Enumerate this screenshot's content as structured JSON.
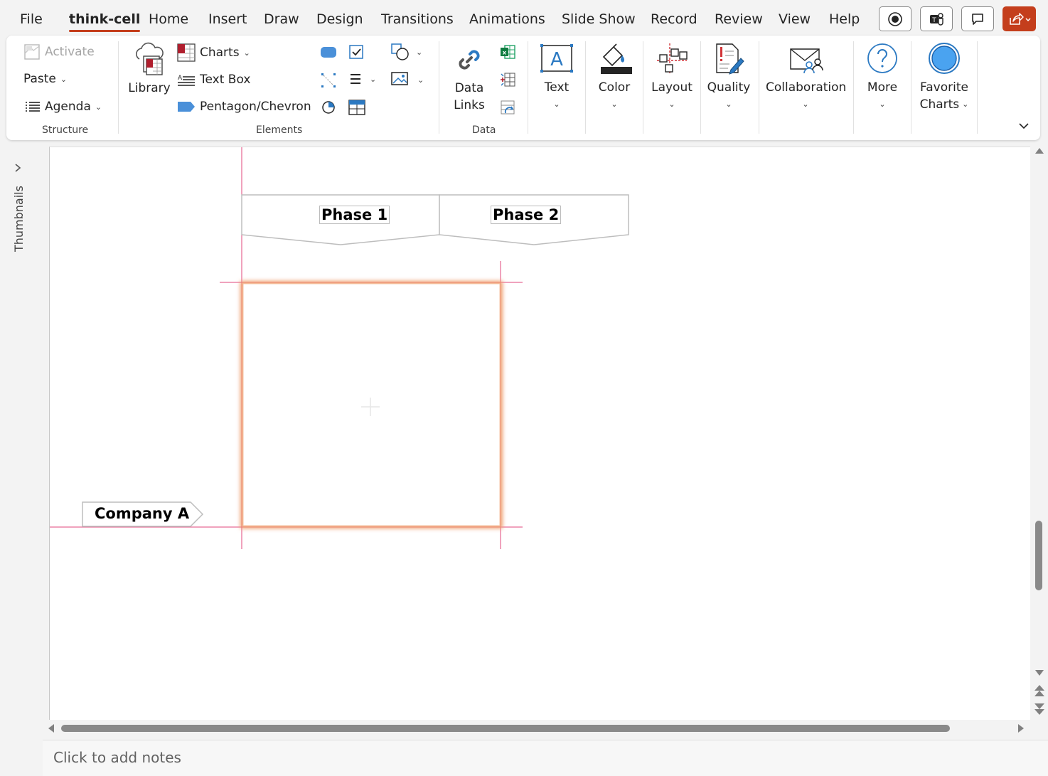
{
  "menu": {
    "items": [
      "File",
      "think-cell",
      "Home",
      "Insert",
      "Draw",
      "Design",
      "Transitions",
      "Animations",
      "Slide Show",
      "Record",
      "Review",
      "View",
      "Help"
    ],
    "active": "think-cell"
  },
  "ribbon": {
    "structure": {
      "activate": "Activate",
      "paste": "Paste",
      "agenda": "Agenda",
      "label": "Structure"
    },
    "elements": {
      "library": "Library",
      "charts": "Charts",
      "text_box": "Text Box",
      "pentagon_chevron": "Pentagon/Chevron",
      "label": "Elements"
    },
    "data": {
      "data_links_line1": "Data",
      "data_links_line2": "Links",
      "label": "Data"
    },
    "text": "Text",
    "color": "Color",
    "layout": "Layout",
    "quality": "Quality",
    "collaboration": "Collaboration",
    "more": "More",
    "favorite_line1": "Favorite",
    "favorite_line2": "Charts"
  },
  "pane": {
    "thumbnails": "Thumbnails"
  },
  "slide": {
    "phase1": "Phase 1",
    "phase2": "Phase 2",
    "company": "Company A"
  },
  "notes": {
    "placeholder": "Click to add notes"
  },
  "colors": {
    "accent": "#c43e1c",
    "guide": "#e0457b",
    "glow": "#f0a070",
    "link_blue": "#2b79c2"
  }
}
